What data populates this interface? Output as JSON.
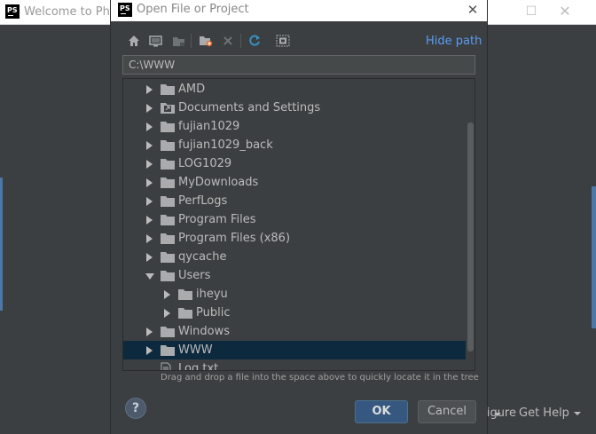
{
  "welcome": {
    "title": "Welcome to PhpStorm",
    "logo_text": "PS",
    "configure_label": "Configure",
    "help_label": "Get Help"
  },
  "dialog": {
    "logo_text": "PS",
    "title": "Open File or Project",
    "close_glyph": "✕",
    "hide_path_label": "Hide path",
    "path_value": "C:\\WWW",
    "drag_hint": "Drag and drop a file into the space above to quickly locate it in the tree",
    "help_glyph": "?",
    "ok_label": "OK",
    "cancel_label": "Cancel"
  },
  "toolbar": {
    "icons": [
      "home-icon",
      "desktop-icon",
      "project-folder-icon",
      "new-folder-icon",
      "delete-icon",
      "refresh-icon",
      "show-hidden-icon"
    ]
  },
  "tree": {
    "items": [
      {
        "label": "AMD",
        "level": 0,
        "state": "collapsed",
        "kind": "folder"
      },
      {
        "label": "Documents and Settings",
        "level": 0,
        "state": "collapsed",
        "kind": "folder-link"
      },
      {
        "label": "fujian1029",
        "level": 0,
        "state": "collapsed",
        "kind": "folder"
      },
      {
        "label": "fujian1029_back",
        "level": 0,
        "state": "collapsed",
        "kind": "folder"
      },
      {
        "label": "LOG1029",
        "level": 0,
        "state": "collapsed",
        "kind": "folder"
      },
      {
        "label": "MyDownloads",
        "level": 0,
        "state": "collapsed",
        "kind": "folder"
      },
      {
        "label": "PerfLogs",
        "level": 0,
        "state": "collapsed",
        "kind": "folder"
      },
      {
        "label": "Program Files",
        "level": 0,
        "state": "collapsed",
        "kind": "folder"
      },
      {
        "label": "Program Files (x86)",
        "level": 0,
        "state": "collapsed",
        "kind": "folder"
      },
      {
        "label": "qycache",
        "level": 0,
        "state": "collapsed",
        "kind": "folder"
      },
      {
        "label": "Users",
        "level": 0,
        "state": "expanded",
        "kind": "folder"
      },
      {
        "label": "iheyu",
        "level": 1,
        "state": "collapsed",
        "kind": "folder"
      },
      {
        "label": "Public",
        "level": 1,
        "state": "collapsed",
        "kind": "folder"
      },
      {
        "label": "Windows",
        "level": 0,
        "state": "collapsed",
        "kind": "folder"
      },
      {
        "label": "WWW",
        "level": 0,
        "state": "collapsed",
        "kind": "folder",
        "selected": true
      },
      {
        "label": "Log.txt",
        "level": 0,
        "state": "none",
        "kind": "file"
      }
    ]
  },
  "colors": {
    "background": "#3c3f41",
    "selection": "#0d293e",
    "link": "#589df6",
    "primary_button": "#365880",
    "folder": "#a9abad"
  }
}
